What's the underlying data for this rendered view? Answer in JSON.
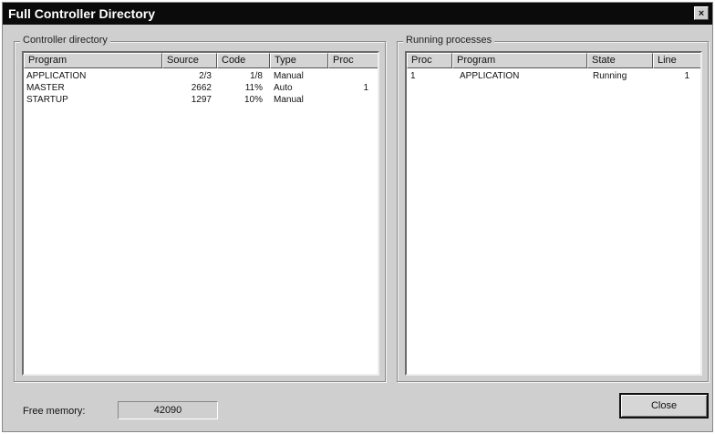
{
  "window": {
    "title": "Full Controller Directory",
    "close_glyph": "×"
  },
  "controller_directory": {
    "group_title": "Controller directory",
    "columns": [
      "Program",
      "Source",
      "Code",
      "Type",
      "Proc"
    ],
    "rows": [
      [
        "APPLICATION",
        "2/3",
        "1/8",
        "Manual",
        ""
      ],
      [
        "MASTER",
        "2662",
        "11%",
        "Auto",
        "1"
      ],
      [
        "STARTUP",
        "1297",
        "10%",
        "Manual",
        ""
      ]
    ]
  },
  "running_processes": {
    "group_title": "Running processes",
    "columns": [
      "Proc",
      "Program",
      "State",
      "Line"
    ],
    "rows": [
      [
        "1",
        "APPLICATION",
        "Running",
        "1"
      ]
    ]
  },
  "footer": {
    "free_memory_label": "Free memory:",
    "free_memory_value": "42090",
    "close_label": "Close"
  }
}
